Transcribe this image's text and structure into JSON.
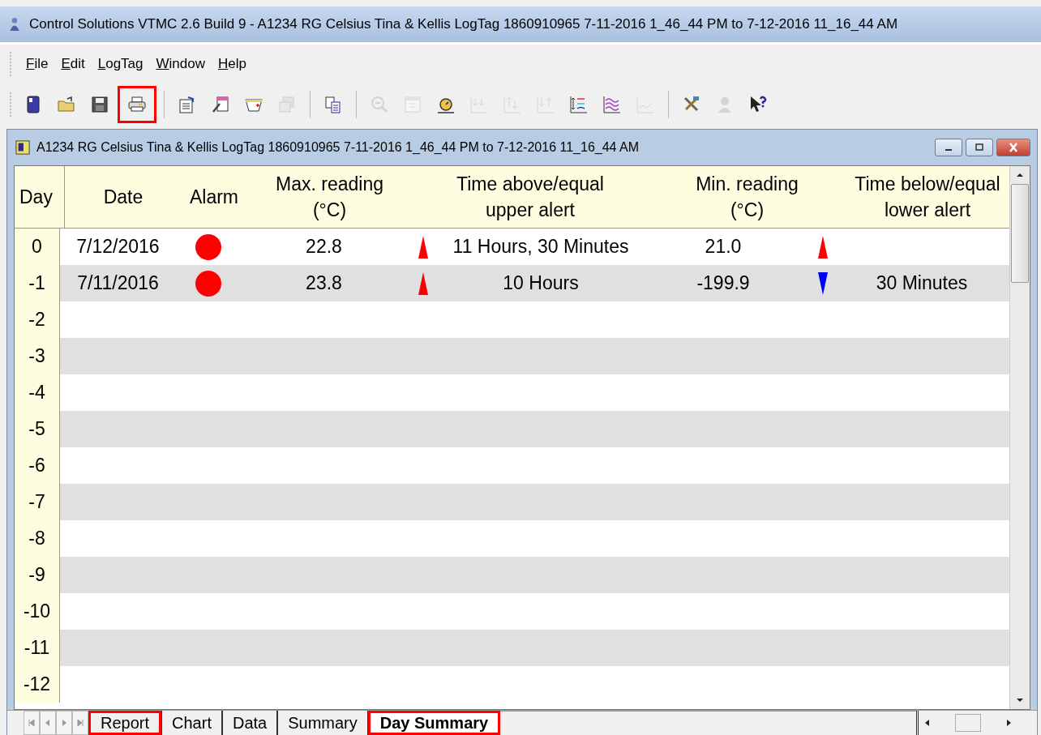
{
  "window": {
    "title": "Control Solutions VTMC 2.6 Build 9 - A1234 RG Celsius Tina & Kellis LogTag 1860910965 7-11-2016 1_46_44 PM to 7-12-2016 11_16_44 AM"
  },
  "menu": [
    {
      "label": "File"
    },
    {
      "label": "Edit"
    },
    {
      "label": "LogTag"
    },
    {
      "label": "Window"
    },
    {
      "label": "Help"
    }
  ],
  "toolbar": [
    {
      "kind": "new",
      "disabled": false,
      "highlighted": false
    },
    {
      "kind": "open",
      "disabled": false,
      "highlighted": false
    },
    {
      "kind": "save",
      "disabled": false,
      "highlighted": false
    },
    {
      "kind": "print",
      "disabled": false,
      "highlighted": true
    },
    {
      "kind": "separator"
    },
    {
      "kind": "properties",
      "disabled": false,
      "highlighted": false
    },
    {
      "kind": "notes",
      "disabled": false,
      "highlighted": false
    },
    {
      "kind": "tag",
      "disabled": false,
      "highlighted": false
    },
    {
      "kind": "stack",
      "disabled": true,
      "highlighted": false
    },
    {
      "kind": "separator"
    },
    {
      "kind": "copy",
      "disabled": false,
      "highlighted": false
    },
    {
      "kind": "separator"
    },
    {
      "kind": "zoom",
      "disabled": true,
      "highlighted": false
    },
    {
      "kind": "calendar",
      "disabled": true,
      "highlighted": false
    },
    {
      "kind": "stopwatch",
      "disabled": false,
      "highlighted": false
    },
    {
      "kind": "chart-down",
      "disabled": true,
      "highlighted": false
    },
    {
      "kind": "chart-updown",
      "disabled": true,
      "highlighted": false
    },
    {
      "kind": "chart-arrows",
      "disabled": true,
      "highlighted": false
    },
    {
      "kind": "chart-mixed",
      "disabled": false,
      "highlighted": false
    },
    {
      "kind": "chart-waves",
      "disabled": false,
      "highlighted": false
    },
    {
      "kind": "chart-line",
      "disabled": true,
      "highlighted": false
    },
    {
      "kind": "separator"
    },
    {
      "kind": "tools",
      "disabled": false,
      "highlighted": false
    },
    {
      "kind": "person",
      "disabled": true,
      "highlighted": false
    },
    {
      "kind": "help",
      "disabled": false,
      "highlighted": false
    }
  ],
  "document": {
    "title": "A1234 RG Celsius Tina & Kellis LogTag 1860910965 7-11-2016 1_46_44 PM to 7-12-2016 11_16_44 AM"
  },
  "table": {
    "columns": [
      {
        "line1": "Day"
      },
      {
        "line1": "Date"
      },
      {
        "line1": "Alarm"
      },
      {
        "line1": "Max. reading",
        "line2": "(°C)"
      },
      {
        "line1": "Time above/equal",
        "line2": "upper alert"
      },
      {
        "line1": "Min. reading",
        "line2": "(°C)"
      },
      {
        "line1": "Time below/equal",
        "line2": "lower alert"
      }
    ],
    "rows": [
      {
        "day": "0",
        "date": "7/12/2016",
        "alarm": true,
        "max": "22.8",
        "max_arrow_up": true,
        "time_above": "11 Hours, 30 Minutes",
        "min": "21.0",
        "min_arrow_up": true
      },
      {
        "day": "-1",
        "date": "7/11/2016",
        "alarm": true,
        "max": "23.8",
        "max_arrow_up": true,
        "time_above": "10 Hours",
        "min": "-199.9",
        "min_arrow_up": false,
        "time_below": "30 Minutes"
      },
      {
        "day": "-2"
      },
      {
        "day": "-3"
      },
      {
        "day": "-4"
      },
      {
        "day": "-5"
      },
      {
        "day": "-6"
      },
      {
        "day": "-7"
      },
      {
        "day": "-8"
      },
      {
        "day": "-9"
      },
      {
        "day": "-10"
      },
      {
        "day": "-11"
      },
      {
        "day": "-12"
      }
    ]
  },
  "tabs": [
    {
      "label": "Report",
      "selected": false,
      "highlighted": true
    },
    {
      "label": "Chart",
      "selected": false,
      "highlighted": false
    },
    {
      "label": "Data",
      "selected": false,
      "highlighted": false
    },
    {
      "label": "Summary",
      "selected": false,
      "highlighted": false
    },
    {
      "label": "Day Summary",
      "selected": true,
      "highlighted": true
    }
  ]
}
